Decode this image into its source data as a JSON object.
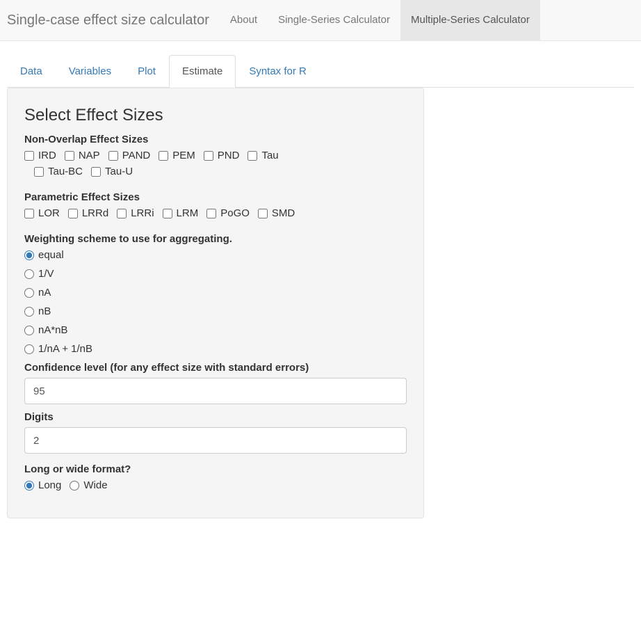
{
  "navbar": {
    "brand": "Single-case effect size calculator",
    "items": [
      {
        "label": "About",
        "active": false
      },
      {
        "label": "Single-Series Calculator",
        "active": false
      },
      {
        "label": "Multiple-Series Calculator",
        "active": true
      }
    ]
  },
  "tabs": [
    {
      "label": "Data",
      "active": false
    },
    {
      "label": "Variables",
      "active": false
    },
    {
      "label": "Plot",
      "active": false
    },
    {
      "label": "Estimate",
      "active": true
    },
    {
      "label": "Syntax for R",
      "active": false
    }
  ],
  "panel": {
    "heading": "Select Effect Sizes",
    "nonOverlap": {
      "label": "Non-Overlap Effect Sizes",
      "options": [
        "IRD",
        "NAP",
        "PAND",
        "PEM",
        "PND",
        "Tau",
        "Tau-BC",
        "Tau-U"
      ]
    },
    "parametric": {
      "label": "Parametric Effect Sizes",
      "options": [
        "LOR",
        "LRRd",
        "LRRi",
        "LRM",
        "PoGO",
        "SMD"
      ]
    },
    "weighting": {
      "label": "Weighting scheme to use for aggregating.",
      "options": [
        "equal",
        "1/V",
        "nA",
        "nB",
        "nA*nB",
        "1/nA + 1/nB"
      ],
      "selected": "equal"
    },
    "confidence": {
      "label": "Confidence level (for any effect size with standard errors)",
      "value": "95"
    },
    "digits": {
      "label": "Digits",
      "value": "2"
    },
    "format": {
      "label": "Long or wide format?",
      "options": [
        "Long",
        "Wide"
      ],
      "selected": "Long"
    }
  }
}
